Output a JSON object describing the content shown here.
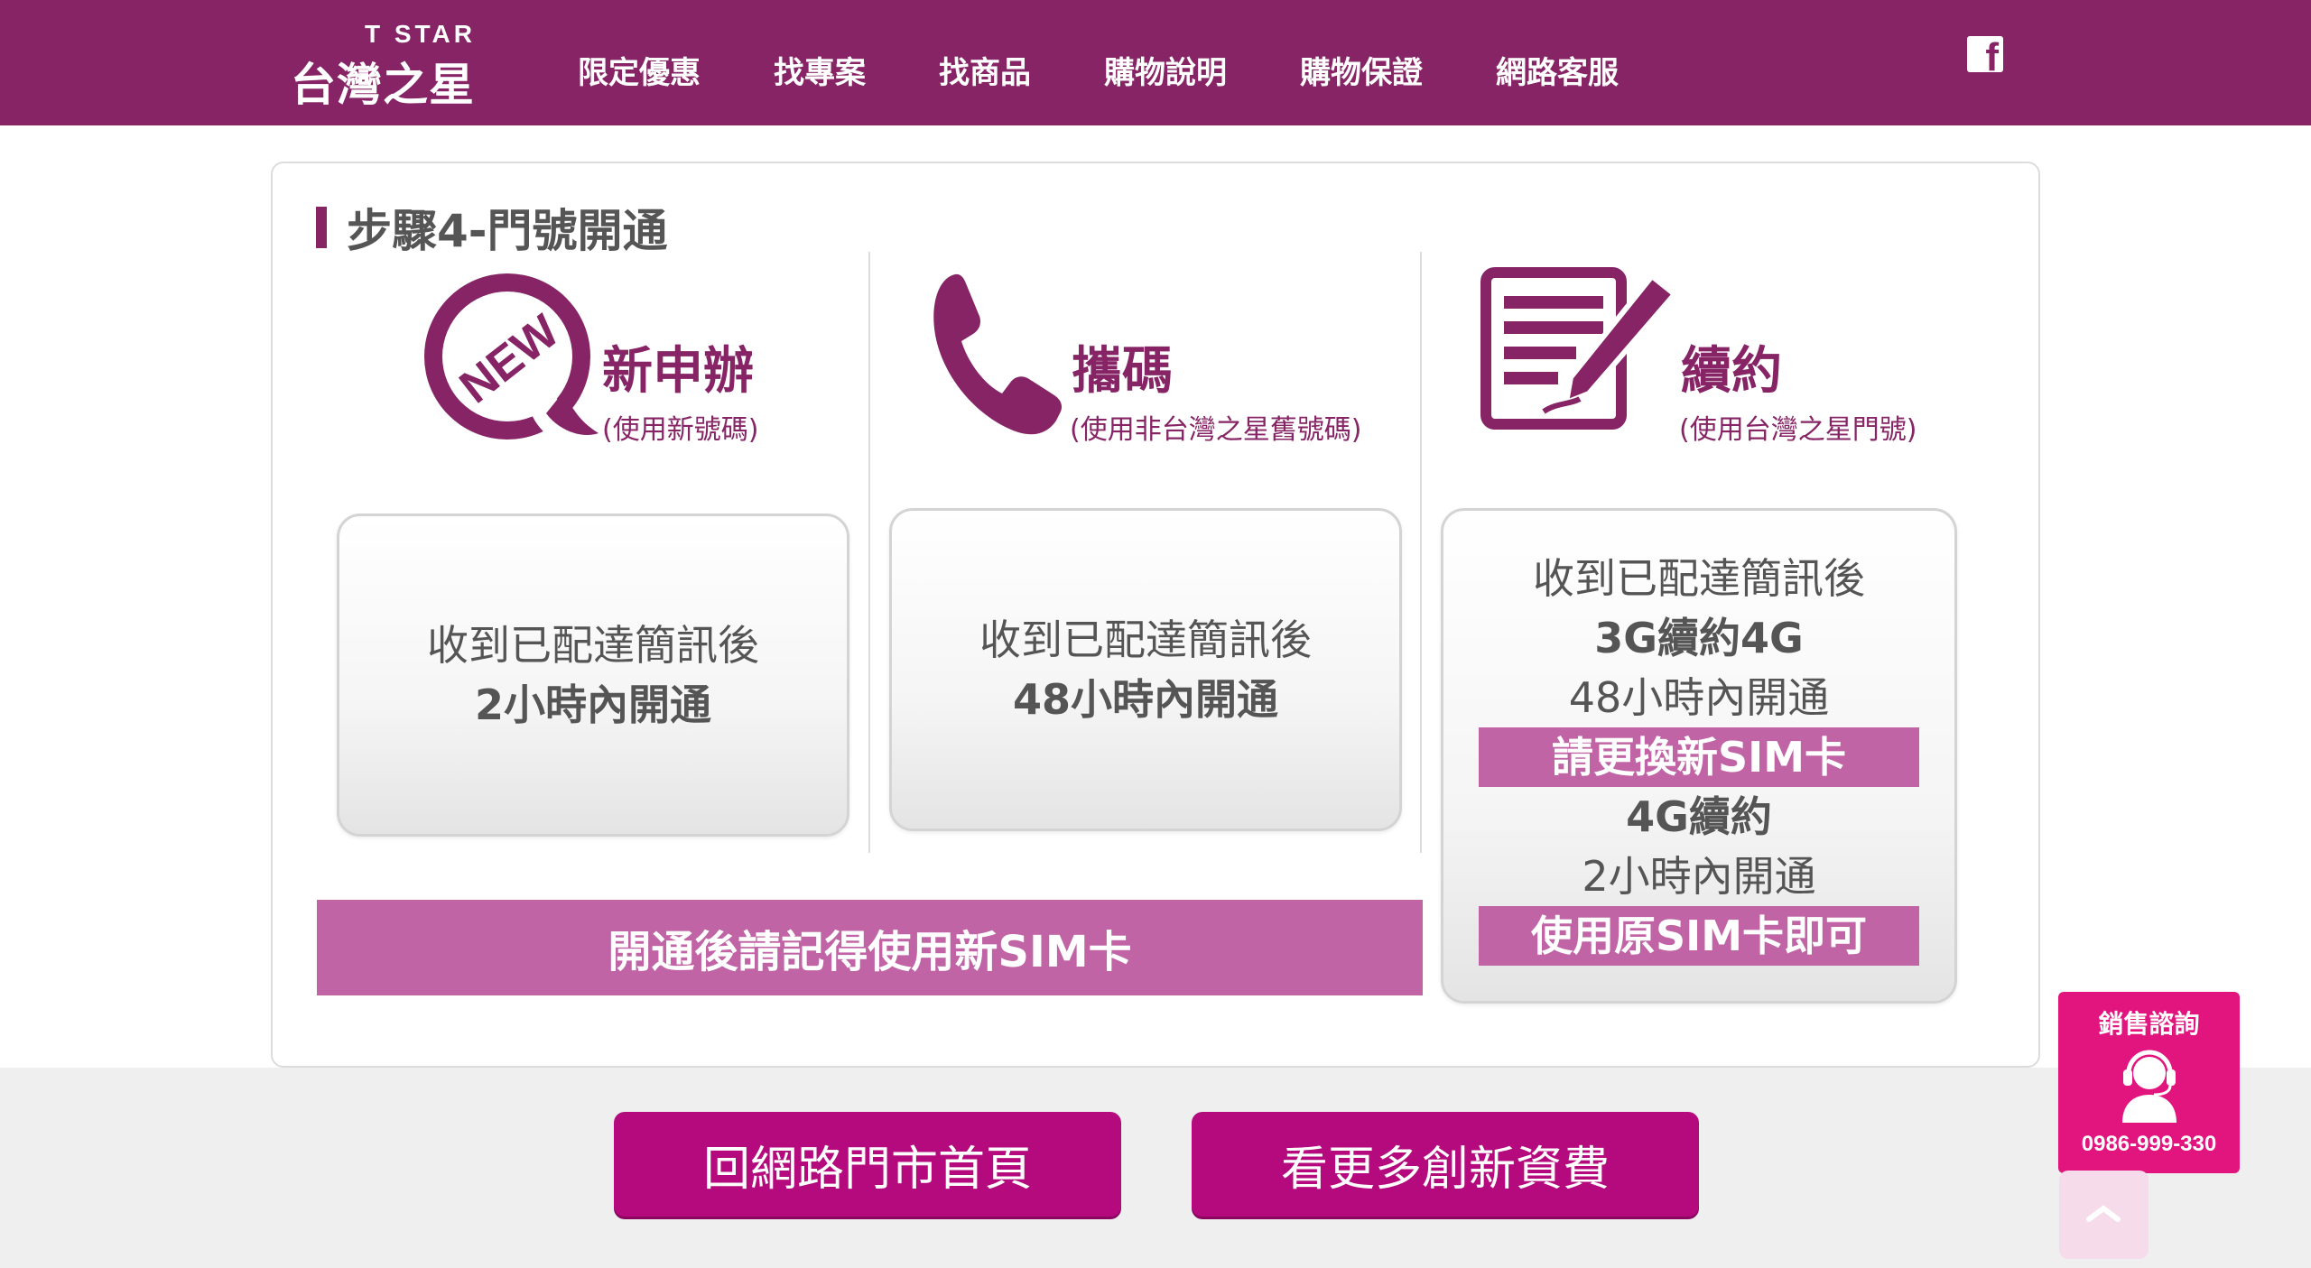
{
  "header": {
    "logo_top": "T STAR",
    "logo_main": "台灣之星",
    "nav": [
      {
        "label": "限定優惠"
      },
      {
        "label": "找專案"
      },
      {
        "label": "找商品"
      },
      {
        "label": "購物說明"
      },
      {
        "label": "購物保證"
      },
      {
        "label": "網路客服"
      }
    ],
    "facebook_icon": "facebook-icon"
  },
  "section": {
    "title": "步驟4-門號開通"
  },
  "columns": [
    {
      "icon": "new-badge-icon",
      "heading": "新申辦",
      "sub": "(使用新號碼)",
      "card": {
        "line1": "收到已配達簡訊後",
        "line2": "2小時內開通"
      }
    },
    {
      "icon": "phone-icon",
      "heading": "攜碼",
      "sub": "(使用非台灣之星舊號碼)",
      "card": {
        "line1": "收到已配達簡訊後",
        "line2": "48小時內開通"
      }
    },
    {
      "icon": "contract-sign-icon",
      "heading": "續約",
      "sub": "(使用台灣之星門號)",
      "card": {
        "line1": "收到已配達簡訊後",
        "line2": "3G續約4G",
        "line3": "48小時內開通",
        "highlight1": "請更換新SIM卡",
        "line4": "4G續約",
        "line5": "2小時內開通",
        "highlight2": "使用原SIM卡即可"
      }
    }
  ],
  "notice": "開通後請記得使用新SIM卡",
  "buttons": {
    "home": "回網路門市首頁",
    "more_plans": "看更多創新資費"
  },
  "sales_widget": {
    "title": "銷售諮詢",
    "phone": "0986-999-330",
    "icon": "headset-agent-icon"
  },
  "scroll_top_icon": "chevron-up-icon",
  "colors": {
    "brand": "#862466",
    "highlight": "#c064a5",
    "button": "#b40a7d",
    "sales": "#e2147d"
  }
}
